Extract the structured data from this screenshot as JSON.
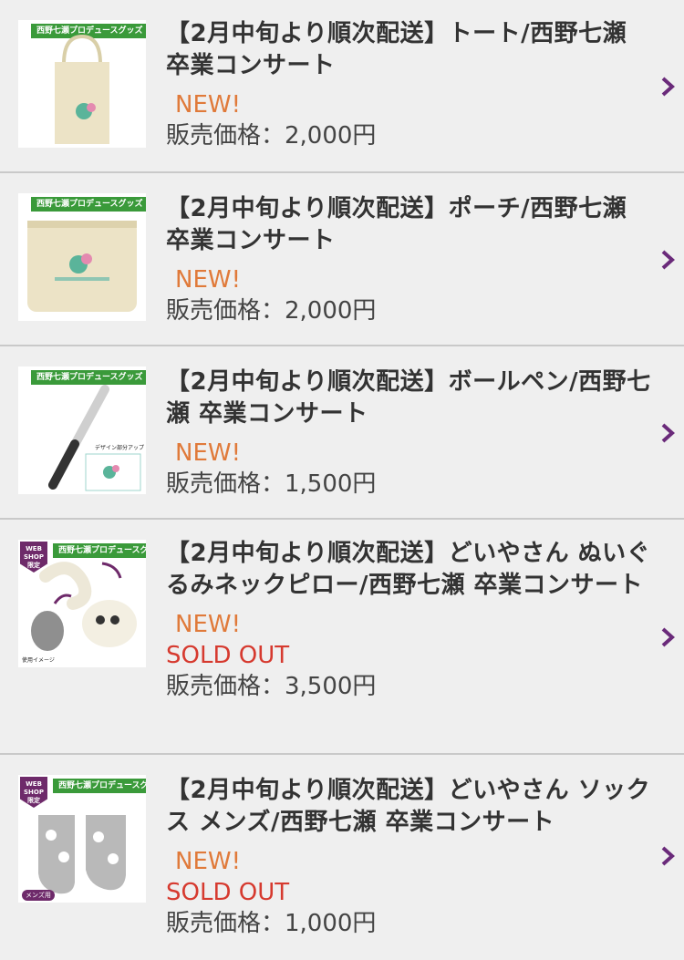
{
  "items": [
    {
      "title": "【2月中旬より順次配送】トート/西野七瀬 卒業コンサート",
      "new_label": "NEW!",
      "price": "販売価格：2,000円",
      "thumb_label": "西野七瀬プロデュースグッズ"
    },
    {
      "title": "【2月中旬より順次配送】ポーチ/西野七瀬 卒業コンサート",
      "new_label": "NEW!",
      "price": "販売価格：2,000円",
      "thumb_label": "西野七瀬プロデュースグッズ"
    },
    {
      "title": "【2月中旬より順次配送】ボールペン/西野七瀬 卒業コンサート",
      "new_label": "NEW!",
      "price": "販売価格：1,500円",
      "thumb_label": "西野七瀬プロデュースグッズ",
      "thumb_caption": "デザイン部分アップ"
    },
    {
      "title": "【2月中旬より順次配送】どいやさん ぬいぐるみネックピロー/西野七瀬 卒業コンサート",
      "new_label": "NEW!",
      "sold_label": "SOLD OUT",
      "price": "販売価格：3,500円",
      "thumb_label": "西野七瀬プロデュースグッズ",
      "badge": "WEB SHOP 限定",
      "thumb_caption": "使用イメージ"
    },
    {
      "title": "【2月中旬より順次配送】どいやさん ソックス メンズ/西野七瀬 卒業コンサート",
      "new_label": "NEW!",
      "sold_label": "SOLD OUT",
      "price": "販売価格：1,000円",
      "thumb_label": "西野七瀬プロデュースグッズ",
      "badge": "WEB SHOP 限定",
      "thumb_caption": "メンズ用"
    }
  ],
  "colors": {
    "new": "#e07a3a",
    "sold": "#d63a2f",
    "chevron": "#6a2a7a",
    "label_green": "#3a9a3a"
  }
}
